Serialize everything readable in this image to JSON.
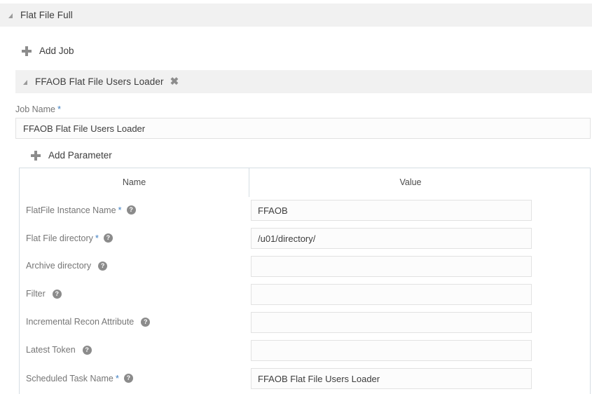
{
  "outer_section": {
    "title": "Flat File Full",
    "expand_icon": "triangle-expanded-icon"
  },
  "add_job_button": {
    "label": "Add Job",
    "icon": "plus-icon"
  },
  "inner_section": {
    "title": "FFAOB Flat File Users Loader",
    "expand_icon": "triangle-expanded-icon",
    "close_icon": "✖"
  },
  "job_name": {
    "label": "Job Name",
    "required_marker": "*",
    "value": "FFAOB Flat File Users Loader",
    "placeholder": ""
  },
  "add_parameter_button": {
    "label": "Add Parameter",
    "icon": "plus-icon"
  },
  "parameters_table": {
    "columns": [
      "Name",
      "Value"
    ],
    "rows": [
      {
        "name": "FlatFile Instance Name",
        "required": true,
        "required_marker": "*",
        "help": "?",
        "value": "FFAOB"
      },
      {
        "name": "Flat File directory",
        "required": true,
        "required_marker": "*",
        "help": "?",
        "value": "/u01/directory/"
      },
      {
        "name": "Archive directory",
        "required": false,
        "required_marker": "",
        "help": "?",
        "value": ""
      },
      {
        "name": "Filter",
        "required": false,
        "required_marker": "",
        "help": "?",
        "value": ""
      },
      {
        "name": "Incremental Recon Attribute",
        "required": false,
        "required_marker": "",
        "help": "?",
        "value": ""
      },
      {
        "name": "Latest Token",
        "required": false,
        "required_marker": "",
        "help": "?",
        "value": ""
      },
      {
        "name": "Scheduled Task Name",
        "required": true,
        "required_marker": "*",
        "help": "?",
        "value": "FFAOB Flat File Users Loader"
      }
    ]
  },
  "colors": {
    "section_bar": "#f1f1f1",
    "table_border": "#d5dde3",
    "input_border": "#e2e2e2",
    "input_bg": "#fcfcfc",
    "required_star": "#3f7fc1",
    "label_text": "#767676",
    "icon_gray": "#8b8b8b"
  }
}
